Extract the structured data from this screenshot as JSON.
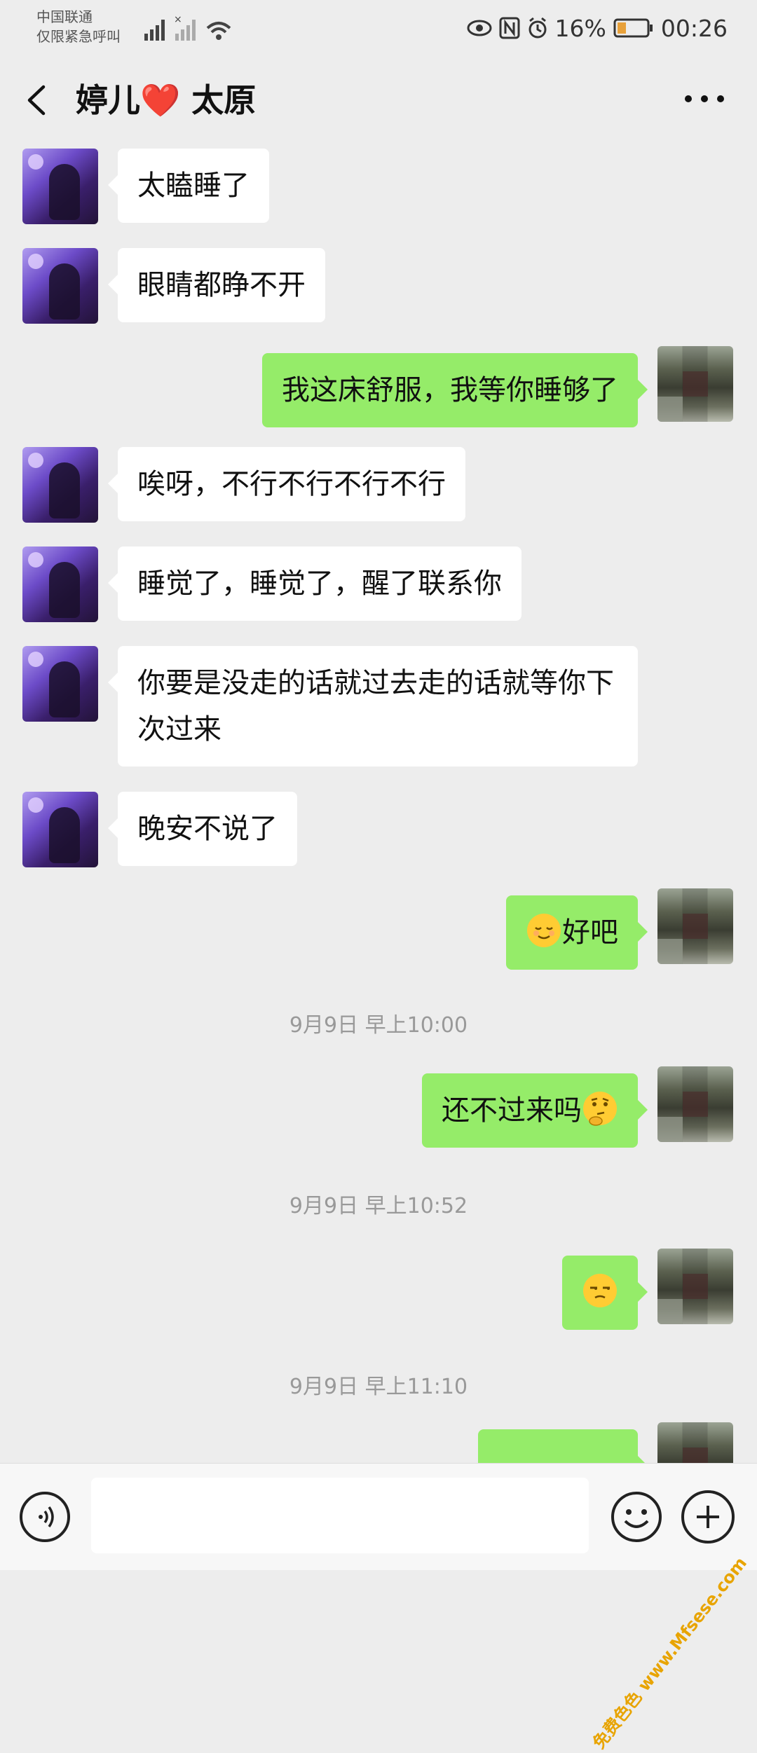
{
  "status_bar": {
    "carrier": "中国联通",
    "emergency": "仅限紧急呼叫",
    "battery": "16%",
    "time": "00:26"
  },
  "header": {
    "title": "婷儿❤️ 太原"
  },
  "messages": [
    {
      "side": "left",
      "text": "太瞌睡了"
    },
    {
      "side": "left",
      "text": "眼睛都睁不开"
    },
    {
      "side": "right",
      "text": "我这床舒服，我等你睡够了"
    },
    {
      "side": "left",
      "text": "唉呀，不行不行不行不行"
    },
    {
      "side": "left",
      "text": "睡觉了，睡觉了，醒了联系你"
    },
    {
      "side": "left",
      "text": "你要是没走的话就过去走的话就等你下次过来"
    },
    {
      "side": "left",
      "text": "晚安不说了"
    },
    {
      "side": "right",
      "text": "好吧",
      "emoji": "relieved-face"
    },
    {
      "type": "time",
      "text": "9月9日 早上10:00"
    },
    {
      "side": "right",
      "text": "还不过来吗",
      "emoji": "thinking-face"
    },
    {
      "type": "time",
      "text": "9月9日 早上10:52"
    },
    {
      "side": "right",
      "emoji": "unamused-face"
    },
    {
      "type": "time",
      "text": "9月9日 早上11:10"
    },
    {
      "side": "right",
      "text": "",
      "partial": true
    }
  ],
  "watermark": "免费色色 www.Mfsese.com",
  "icons": [
    "back-arrow-icon",
    "more-dots-icon",
    "voice-icon",
    "emoji-icon",
    "plus-icon",
    "eye-icon",
    "nfc-icon",
    "alarm-icon",
    "battery-icon",
    "wifi-icon",
    "signal-icon"
  ]
}
